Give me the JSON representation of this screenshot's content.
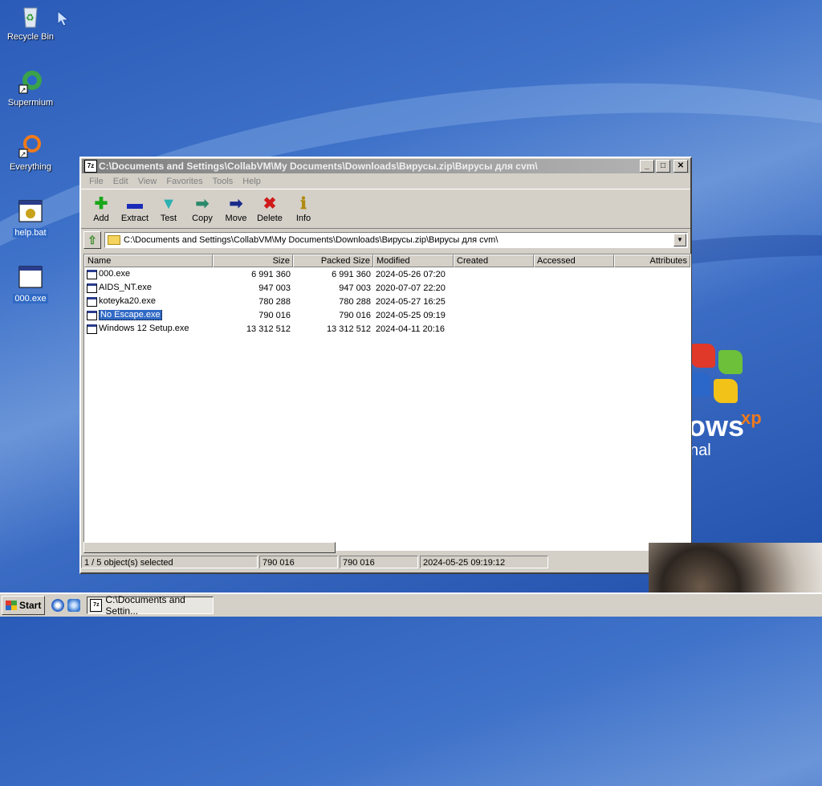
{
  "desktop": {
    "icons": [
      {
        "label": "Recycle Bin",
        "icon": "recycle-bin-icon"
      },
      {
        "label": "Supermium",
        "icon": "supermium-icon"
      },
      {
        "label": "Everything",
        "icon": "everything-icon"
      },
      {
        "label": "help.bat",
        "icon": "bat-file-icon"
      },
      {
        "label": "000.exe",
        "icon": "exe-file-icon"
      }
    ],
    "logo": {
      "text": "ows",
      "sup": "xp",
      "edition": "nal"
    }
  },
  "window": {
    "title": "C:\\Documents and Settings\\CollabVM\\My Documents\\Downloads\\Вирусы.zip\\Вирусы для cvm\\",
    "app_icon_text": "7z",
    "controls": {
      "minimize": "_",
      "maximize": "□",
      "close": "✕"
    },
    "menu": [
      "File",
      "Edit",
      "View",
      "Favorites",
      "Tools",
      "Help"
    ],
    "toolbar": [
      {
        "label": "Add",
        "icon": "add-icon",
        "glyph": "✚",
        "color": "#1aa71a"
      },
      {
        "label": "Extract",
        "icon": "extract-icon",
        "glyph": "▬",
        "color": "#1a2ab8"
      },
      {
        "label": "Test",
        "icon": "test-icon",
        "glyph": "▼",
        "color": "#2bb0b0"
      },
      {
        "label": "Copy",
        "icon": "copy-icon",
        "glyph": "➡",
        "color": "#2a8a6a"
      },
      {
        "label": "Move",
        "icon": "move-icon",
        "glyph": "➡",
        "color": "#1a2a8a"
      },
      {
        "label": "Delete",
        "icon": "delete-icon",
        "glyph": "✖",
        "color": "#d01a1a"
      },
      {
        "label": "Info",
        "icon": "info-icon",
        "glyph": "ℹ",
        "color": "#b08a10"
      }
    ],
    "address": "C:\\Documents and Settings\\CollabVM\\My Documents\\Downloads\\Вирусы.zip\\Вирусы для cvm\\",
    "columns": [
      "Name",
      "Size",
      "Packed Size",
      "Modified",
      "Created",
      "Accessed",
      "Attributes"
    ],
    "files": [
      {
        "name": "000.exe",
        "size": "6 991 360",
        "packed": "6 991 360",
        "modified": "2024-05-26 07:20",
        "selected": false
      },
      {
        "name": "AIDS_NT.exe",
        "size": "947 003",
        "packed": "947 003",
        "modified": "2020-07-07 22:20",
        "selected": false
      },
      {
        "name": "koteyka20.exe",
        "size": "780 288",
        "packed": "780 288",
        "modified": "2024-05-27 16:25",
        "selected": false
      },
      {
        "name": "No Escape.exe",
        "size": "790 016",
        "packed": "790 016",
        "modified": "2024-05-25 09:19",
        "selected": true
      },
      {
        "name": "Windows 12 Setup.exe",
        "size": "13 312 512",
        "packed": "13 312 512",
        "modified": "2024-04-11 20:16",
        "selected": false
      }
    ],
    "status": {
      "selection": "1 / 5 object(s) selected",
      "size": "790 016",
      "packed": "790 016",
      "modified": "2024-05-25 09:19:12"
    }
  },
  "taskbar": {
    "start_label": "Start",
    "task_label": "C:\\Documents and Settin...",
    "task_icon_text": "7z"
  }
}
